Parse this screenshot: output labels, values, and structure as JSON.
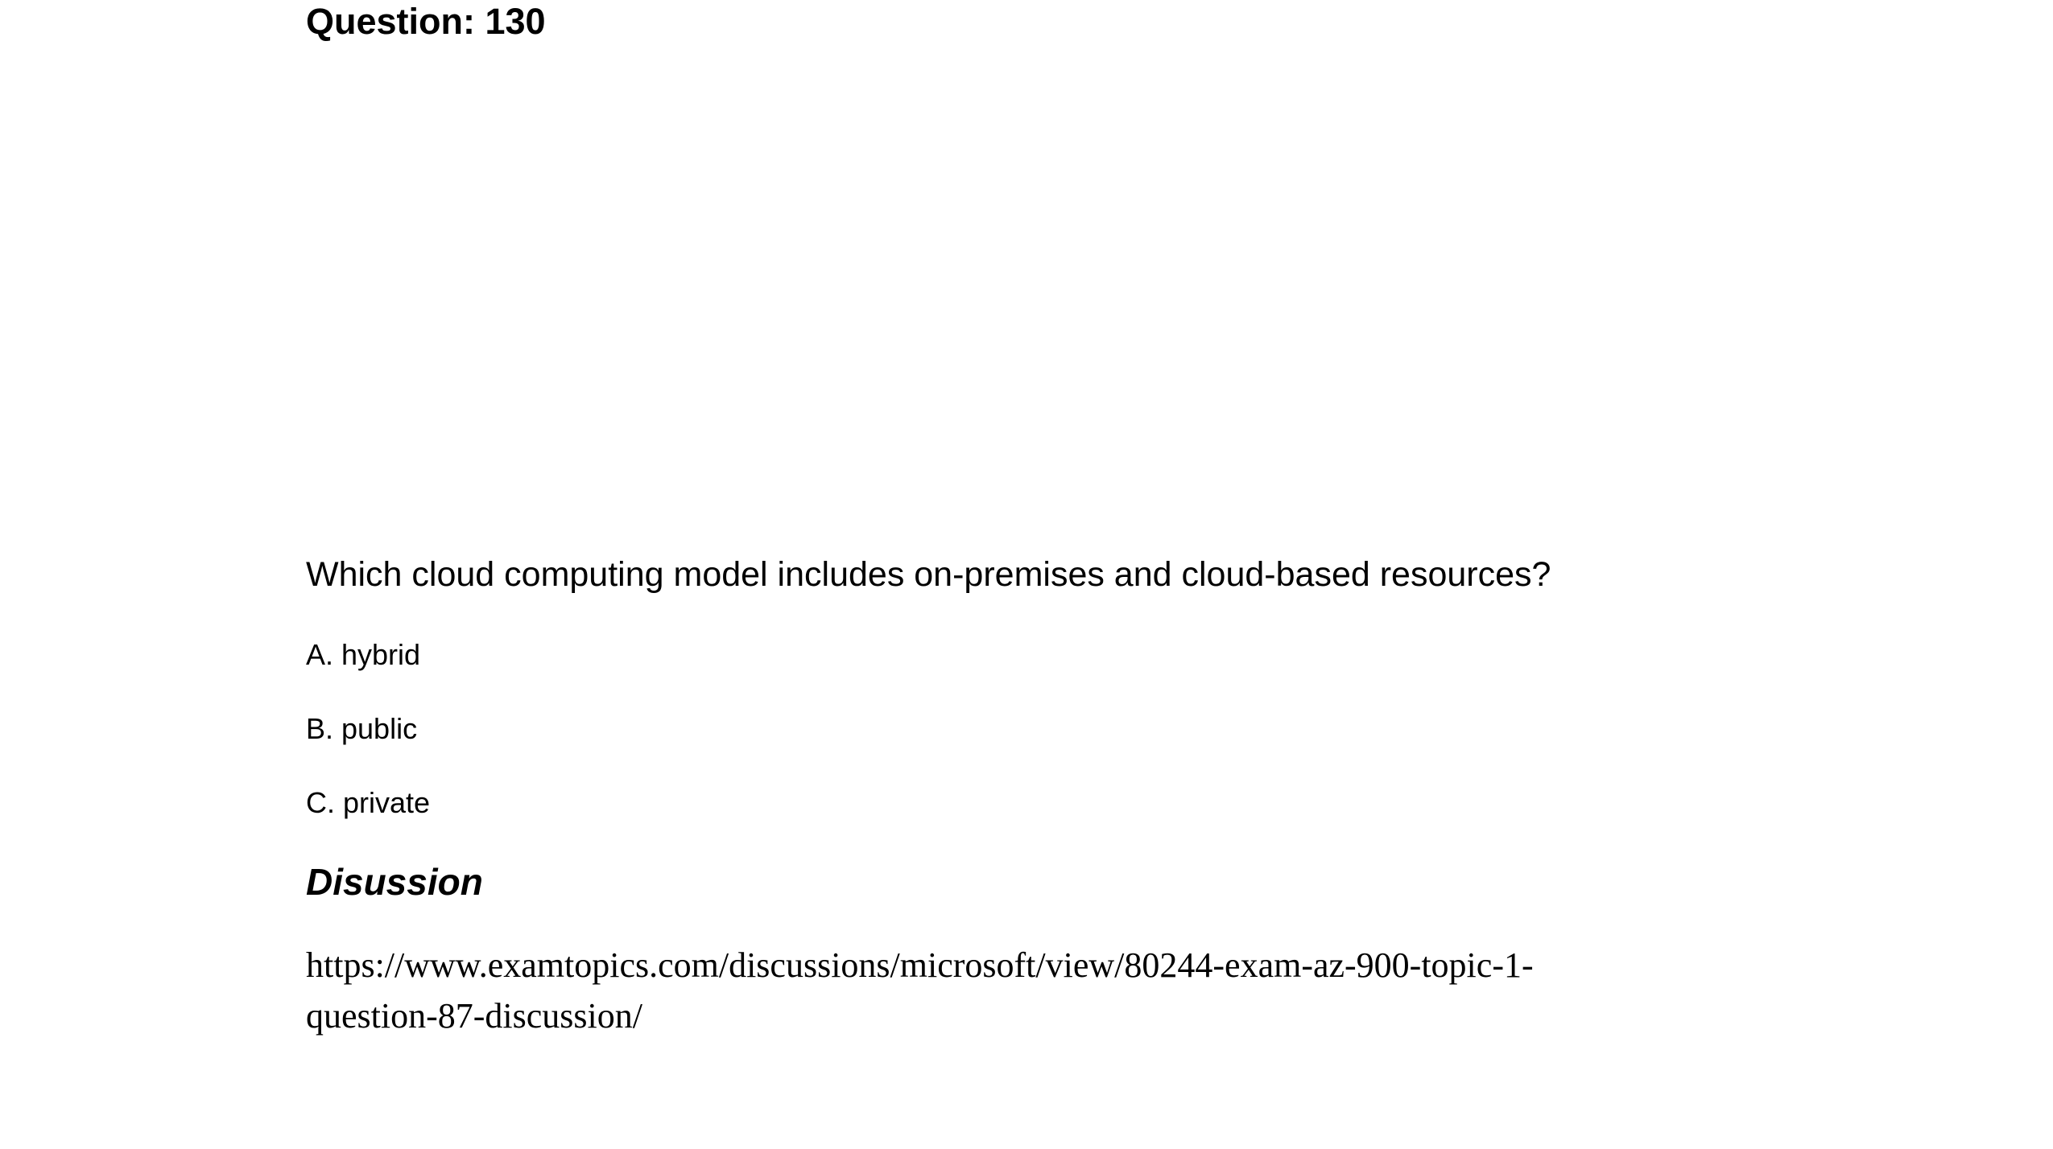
{
  "question": {
    "header": "Question: 130",
    "text": "Which cloud computing model includes on-premises and cloud-based resources?",
    "options": [
      {
        "label": "A. hybrid"
      },
      {
        "label": "B. public"
      },
      {
        "label": "C. private"
      }
    ]
  },
  "discussion": {
    "heading": "Disussion",
    "link_line1": "https://www.examtopics.com/discussions/microsoft/view/80244-exam-az-900-topic-1-",
    "link_line2": "question-87-discussion/"
  }
}
